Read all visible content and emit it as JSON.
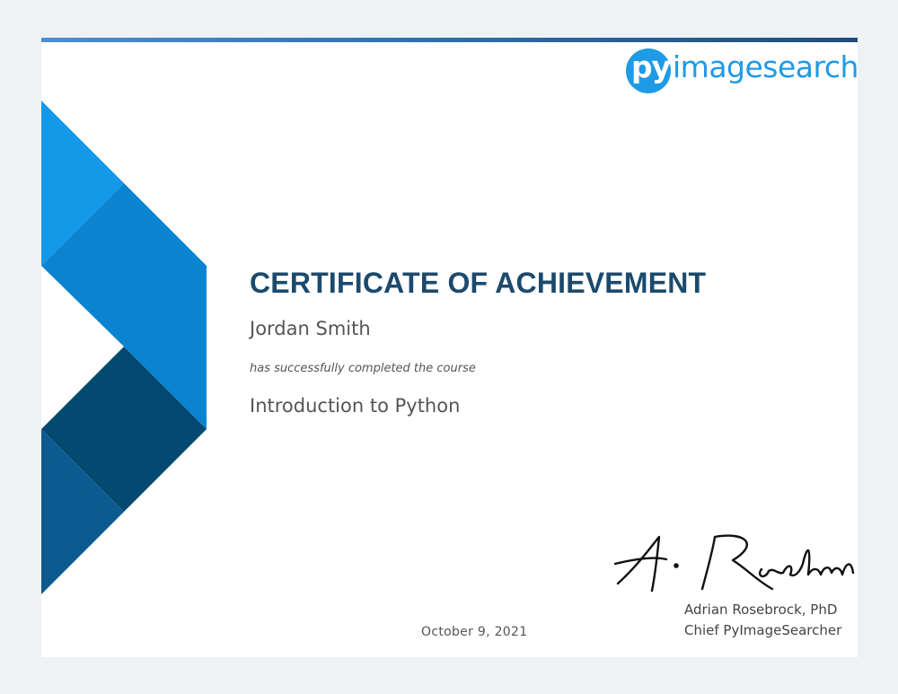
{
  "logo": {
    "prefix": "py",
    "word": "imagesearch",
    "color": "#1f9ae6"
  },
  "certificate": {
    "title": "CERTIFICATE OF ACHIEVEMENT",
    "recipient": "Jordan Smith",
    "completion_text": "has successfully completed the course",
    "course": "Introduction to Python",
    "date": "October 9, 2021"
  },
  "signer": {
    "signature_text": "A. Rosebrock",
    "name": "Adrian Rosebrock, PhD",
    "role": "Chief PyImageSearcher"
  },
  "colors": {
    "title": "#1b4a6d",
    "accent_light": "#1499e8",
    "accent_mid": "#0b84cf",
    "accent_dark": "#0b5a90",
    "accent_darkest": "#044a70"
  }
}
